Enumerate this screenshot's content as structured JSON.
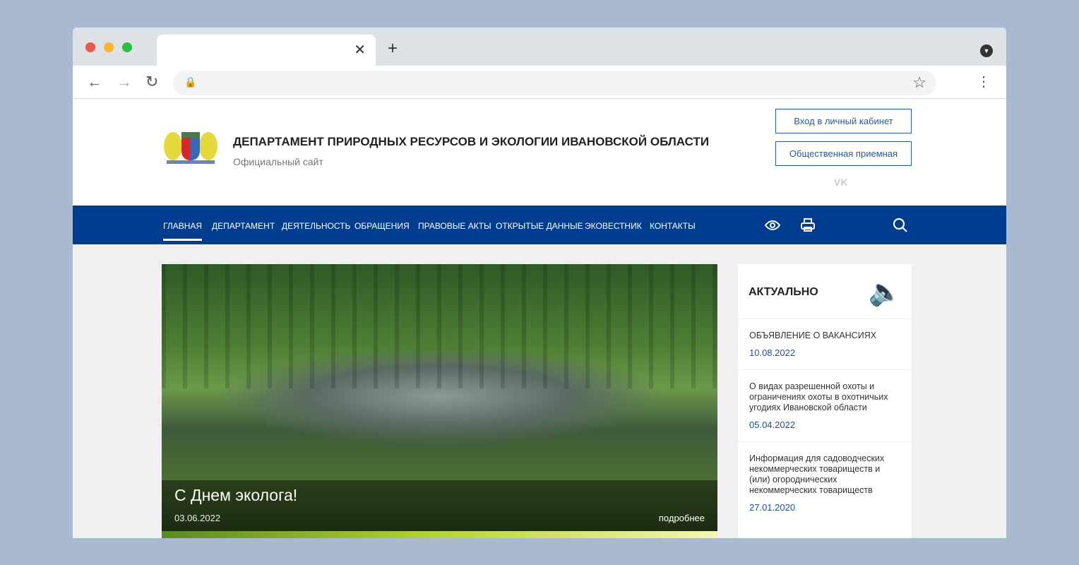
{
  "browser": {
    "close": "✕",
    "new_tab": "+",
    "back": "←",
    "forward": "→",
    "reload": "↻",
    "lock": "🔒",
    "star": "☆",
    "menu": "⋮",
    "dropdown": "▼"
  },
  "header": {
    "title": "ДЕПАРТАМЕНТ ПРИРОДНЫХ РЕСУРСОВ И ЭКОЛОГИИ ИВАНОВСКОЙ ОБЛАСТИ",
    "subtitle": "Официальный сайт",
    "login": "Вход в личный кабинет",
    "reception": "Общественная приемная",
    "vk": "VK"
  },
  "nav": [
    "ГЛАВНАЯ",
    "ДЕПАРТАМЕНТ",
    "ДЕЯТЕЛЬНОСТЬ",
    "ОБРАЩЕНИЯ",
    "ПРАВОВЫЕ АКТЫ",
    "ОТКРЫТЫЕ ДАННЫЕ",
    "ЭКОВЕСТНИК",
    "КОНТАКТЫ"
  ],
  "slide": {
    "title": "С Днем эколога!",
    "date": "03.06.2022",
    "more": "подробнее"
  },
  "sidebar": {
    "title": "АКТУАЛЬНО",
    "items": [
      {
        "text": "ОБЪЯВЛЕНИЕ О ВАКАНСИЯХ",
        "date": "10.08.2022"
      },
      {
        "text": "О видах разрешенной охоты и ограничениях охоты в охотничьих угодиях Ивановской области",
        "date": "05.04.2022"
      },
      {
        "text": "Информация для садоводческих некоммерческих товариществ и (или) огороднических некоммерческих товариществ",
        "date": "27.01.2020"
      }
    ]
  }
}
